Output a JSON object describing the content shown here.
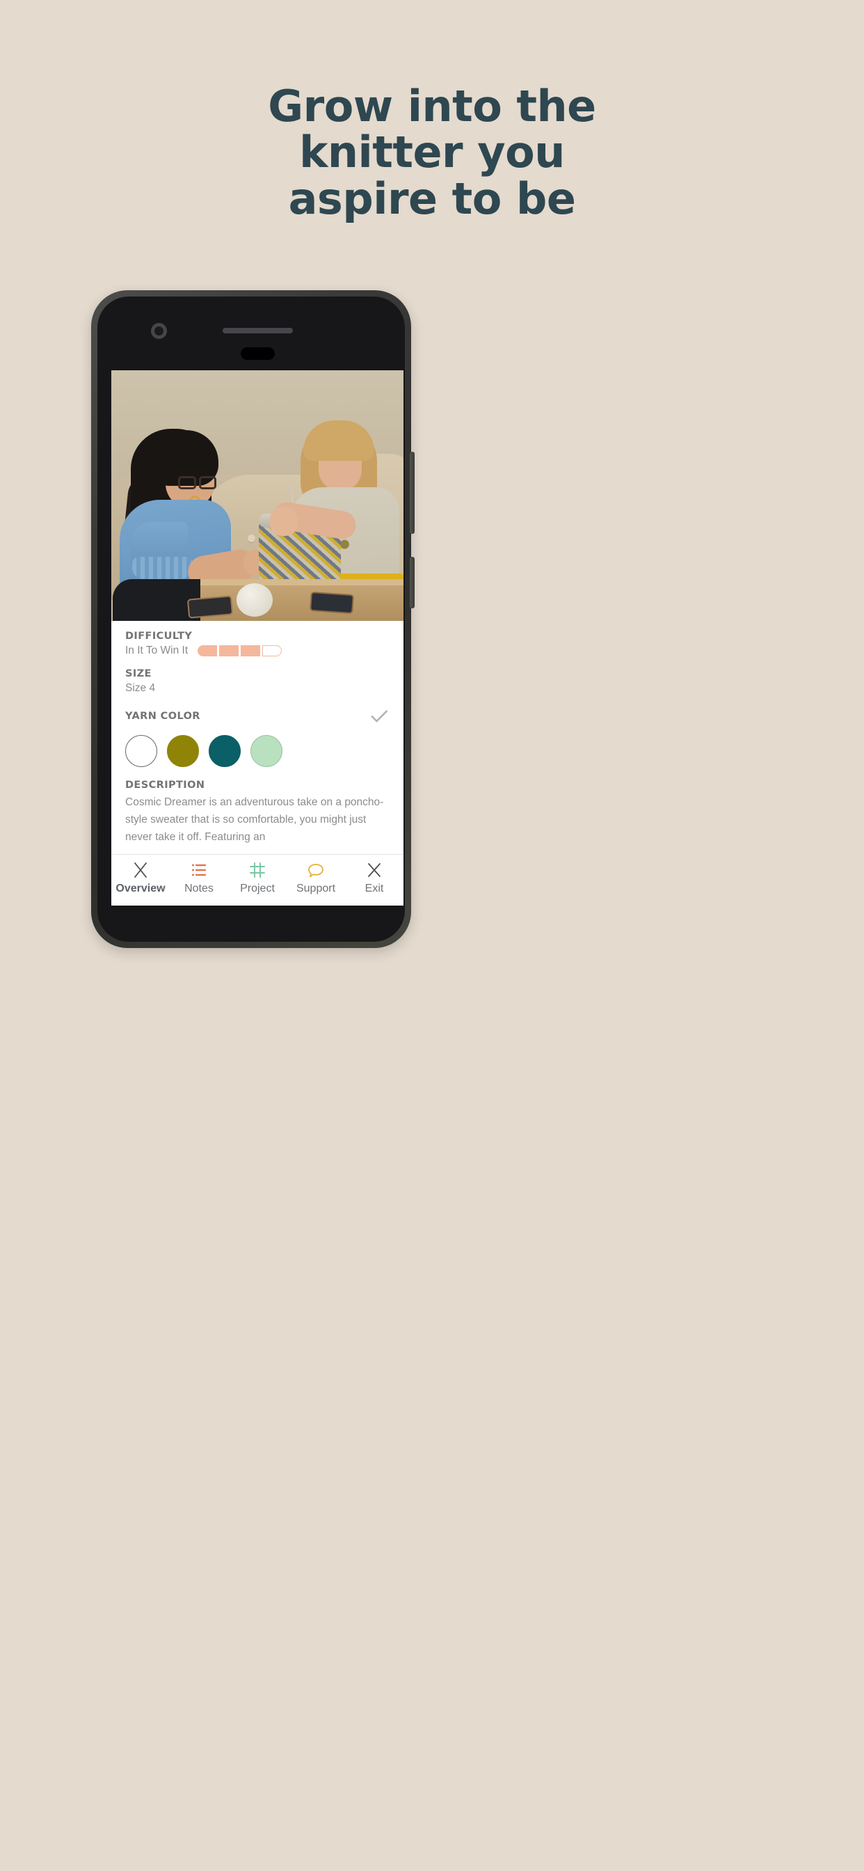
{
  "page": {
    "background_color": "#e4dace",
    "headline_color": "#2e4750",
    "headline_lines": [
      "Grow into the",
      "knitter you",
      "aspire to be"
    ]
  },
  "device": {
    "frame_color": "#3a3a38",
    "camera_icon": "camera-lens-icon",
    "speaker_icon": "speaker-grill-icon",
    "earpiece_icon": "earpiece-icon"
  },
  "screen": {
    "hero": {
      "alt": "Two women knitting together on a sofa",
      "image_name": "knitting-session-photo"
    },
    "details": {
      "difficulty": {
        "label": "DIFFICULTY",
        "value": "In It To Win It",
        "level": 3,
        "total": 4,
        "fill_color": "#f4b79c"
      },
      "size": {
        "label": "SIZE",
        "value": "Size 4"
      },
      "yarn_color": {
        "label": "YARN COLOR",
        "check_icon": "check-icon",
        "swatches": [
          {
            "name": "white",
            "hex": "#ffffff"
          },
          {
            "name": "olive",
            "hex": "#8f8407"
          },
          {
            "name": "teal",
            "hex": "#0b5f66"
          },
          {
            "name": "mint",
            "hex": "#b9e0bf"
          }
        ]
      },
      "description": {
        "label": "DESCRIPTION",
        "text": "Cosmic Dreamer is an adventurous take on a poncho-style sweater that is so comfortable, you might just never take it off. Featuring an"
      }
    },
    "bottom_nav": {
      "items": [
        {
          "label": "Overview",
          "icon": "knitting-needles-icon",
          "icon_color": "#4d4f52",
          "active": true
        },
        {
          "label": "Notes",
          "icon": "list-icon",
          "icon_color": "#e8744a",
          "active": false
        },
        {
          "label": "Project",
          "icon": "grid-frame-icon",
          "icon_color": "#7cc4a4",
          "active": false
        },
        {
          "label": "Support",
          "icon": "speech-bubble-icon",
          "icon_color": "#e3b23c",
          "active": false
        },
        {
          "label": "Exit",
          "icon": "close-x-icon",
          "icon_color": "#4d4f52",
          "active": false
        }
      ]
    }
  }
}
